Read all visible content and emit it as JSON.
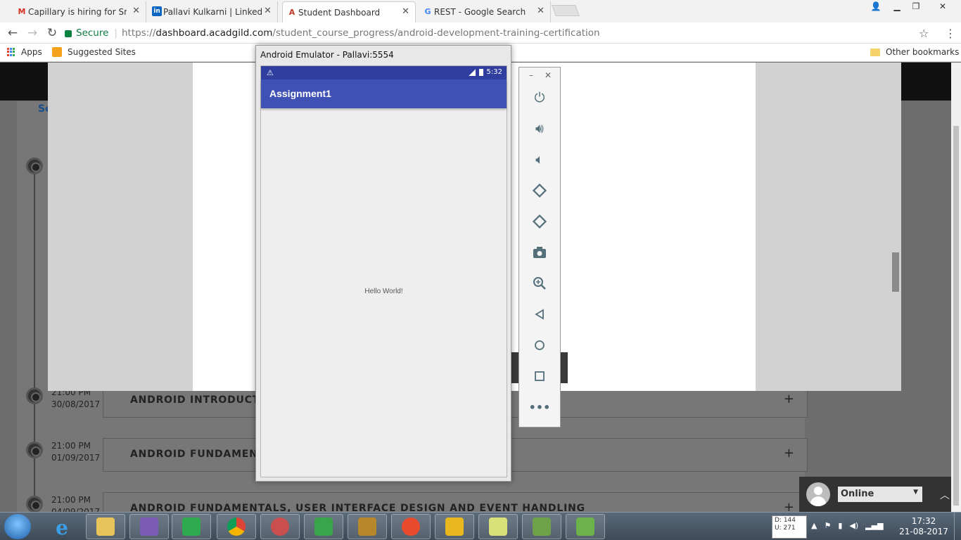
{
  "browser": {
    "tabs": [
      {
        "title": "Capillary is hiring for Sr. S",
        "favicon": "M",
        "favicon_color": "#d93025",
        "active": false
      },
      {
        "title": "Pallavi Kulkarni | LinkedIn",
        "favicon": "in",
        "favicon_color": "#0a66c2",
        "active": false
      },
      {
        "title": "Student Dashboard",
        "favicon": "A",
        "favicon_color": "#c0392b",
        "active": true
      },
      {
        "title": "REST - Google Search",
        "favicon": "G",
        "favicon_color": "#4285f4",
        "active": false
      }
    ],
    "secure_label": "Secure",
    "url_scheme": "https://",
    "url_host": "dashboard.acadgild.com",
    "url_path": "/student_course_progress/android-development-training-certification",
    "bookmarks": {
      "apps": "Apps",
      "suggested": "Suggested Sites",
      "other": "Other bookmarks"
    }
  },
  "page": {
    "sidebar_text": "Se",
    "sessions": [
      {
        "time": "21:00 PM",
        "date": "30/08/2017",
        "title": "ANDROID INTRODUCTIO"
      },
      {
        "time": "21:00 PM",
        "date": "01/09/2017",
        "title": "ANDROID FUNDAMENTA"
      },
      {
        "time": "21:00 PM",
        "date": "04/09/2017",
        "title": "ANDROID FUNDAMENTALS, USER INTERFACE DESIGN AND EVENT HANDLING"
      }
    ],
    "plus_icon": "+"
  },
  "emulator": {
    "window_title": "Android Emulator - Pallavi:5554",
    "status_time": "5:32",
    "app_title": "Assignment1",
    "body_text": "Hello World!",
    "accent_color": "#3f51b5",
    "status_color": "#303f9f",
    "tools": [
      "power-icon",
      "volume-up-icon",
      "volume-down-icon",
      "rotate-left-icon",
      "rotate-right-icon",
      "camera-icon",
      "zoom-icon",
      "back-icon",
      "home-icon",
      "overview-icon",
      "more-icon"
    ]
  },
  "chat": {
    "status": "Online"
  },
  "taskbar": {
    "net_down": "D: 144",
    "net_up": "U: 271",
    "time": "17:32",
    "date": "21-08-2017"
  }
}
